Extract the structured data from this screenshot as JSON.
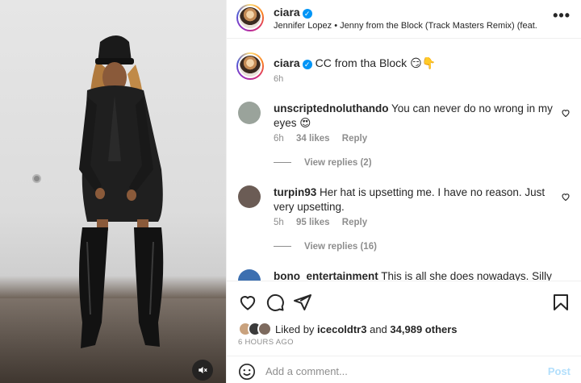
{
  "post": {
    "author": "ciara",
    "audio": "Jennifer Lopez • Jenny from the Block (Track Masters Remix) (feat.",
    "caption_text": "CC from tha Block 😏👇",
    "caption_time": "6h",
    "more_label": "•••"
  },
  "comments": [
    {
      "username": "unscriptednoluthando",
      "text": "You can never do no wrong in my eyes 😍",
      "time": "6h",
      "likes": "34 likes",
      "reply": "Reply",
      "view_replies": "View replies (2)",
      "avatar_color": "#9aa39b"
    },
    {
      "username": "turpin93",
      "text": "Her hat is upsetting me. I have no reason. Just very upsetting.",
      "time": "5h",
      "likes": "95 likes",
      "reply": "Reply",
      "view_replies": "View replies (16)",
      "avatar_color": "#6b5c55"
    },
    {
      "username": "bono_entertainment",
      "text": "This is all she does nowadays. Silly",
      "avatar_color": "#3c6fb0"
    }
  ],
  "likes_bar": {
    "prefix": "Liked by",
    "user": "icecoldtr3",
    "middle": "and",
    "count": "34,989 others",
    "avatar_colors": [
      "#c9a27e",
      "#3b3b3b",
      "#7d6a5e"
    ]
  },
  "post_time": "6 HOURS AGO",
  "comment_box": {
    "placeholder": "Add a comment...",
    "post_label": "Post"
  },
  "icons": {
    "like": "heart-icon",
    "comment": "comment-icon",
    "share": "send-icon",
    "save": "bookmark-icon",
    "mute": "speaker-muted-icon",
    "emoji": "emoji-icon"
  },
  "colors": {
    "accent": "#0095f6",
    "post_disabled": "#b2dffc",
    "secondary_text": "#8e8e8e"
  }
}
